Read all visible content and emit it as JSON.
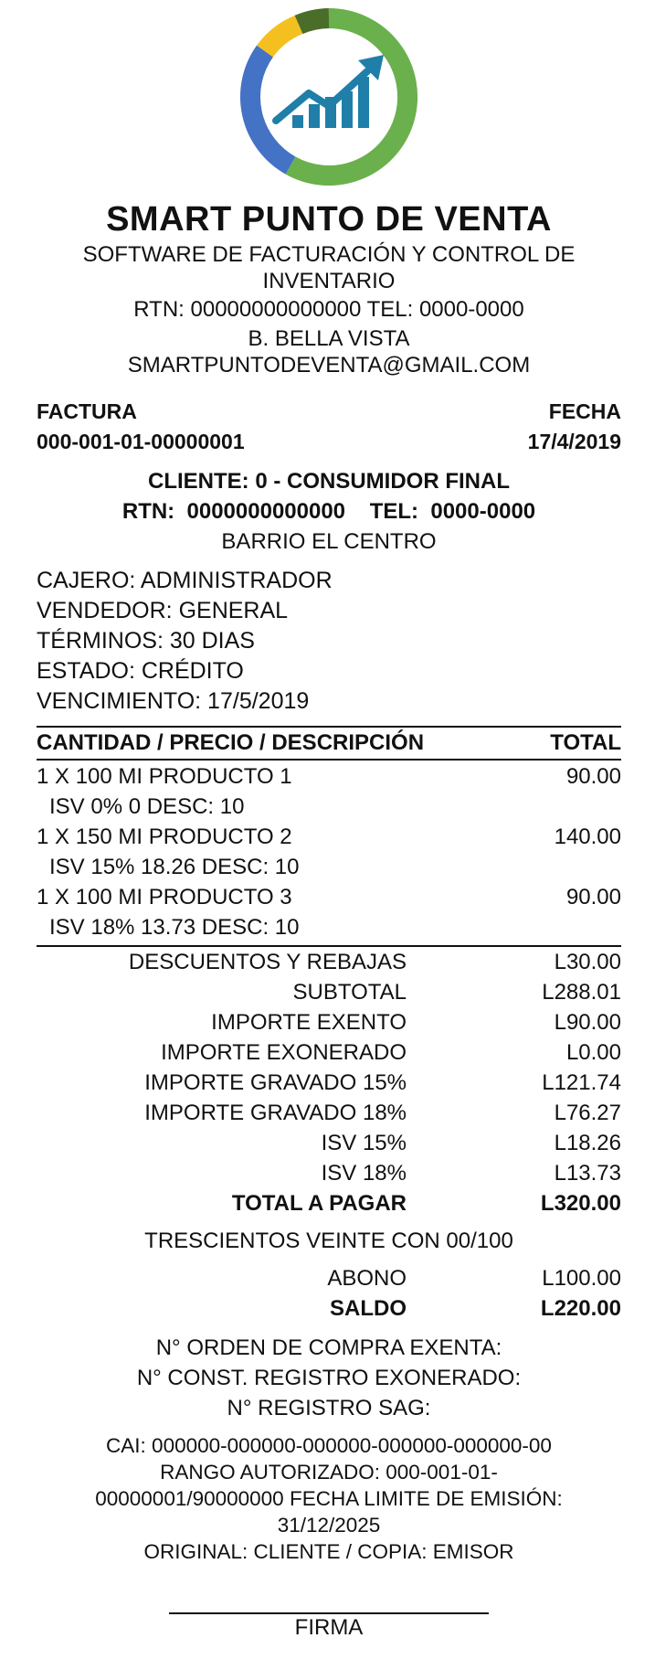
{
  "logo": {
    "icon": "chart-growth-icon",
    "ring_colors": [
      "#6ab04c",
      "#4472c4",
      "#f4c020",
      "#4a6e2a"
    ],
    "chart_color": "#1f7fa8"
  },
  "header": {
    "title": "SMART PUNTO DE VENTA",
    "subtitle_line1": "SOFTWARE DE FACTURACIÓN Y CONTROL DE",
    "subtitle_line2": "INVENTARIO",
    "rtn_tel": "RTN: 00000000000000 TEL: 0000-0000",
    "address": "B. BELLA VISTA",
    "email": "SMARTPUNTODEVENTA@GMAIL.COM"
  },
  "invoice": {
    "factura_label": "FACTURA",
    "fecha_label": "FECHA",
    "number": "000-001-01-00000001",
    "date": "17/4/2019"
  },
  "client": {
    "line1": "CLIENTE: 0 - CONSUMIDOR FINAL",
    "rtn_tel": "RTN:  0000000000000    TEL:  0000-0000",
    "address": "BARRIO EL CENTRO"
  },
  "meta": [
    "CAJERO: ADMINISTRADOR",
    "VENDEDOR: GENERAL",
    "TÉRMINOS: 30 DIAS",
    "ESTADO: CRÉDITO",
    "VENCIMIENTO: 17/5/2019"
  ],
  "items_header": {
    "description": "CANTIDAD / PRECIO / DESCRIPCIÓN",
    "total": "TOTAL"
  },
  "items": [
    {
      "line": "1 X 100 MI PRODUCTO 1",
      "total": "90.00",
      "detail": "ISV 0% 0 DESC: 10"
    },
    {
      "line": "1 X 150 MI PRODUCTO 2",
      "total": "140.00",
      "detail": "ISV 15% 18.26 DESC: 10"
    },
    {
      "line": "1 X 100 MI PRODUCTO 3",
      "total": "90.00",
      "detail": "ISV 18% 13.73 DESC: 10"
    }
  ],
  "totals": [
    {
      "label": "DESCUENTOS Y REBAJAS",
      "value": "L30.00"
    },
    {
      "label": "SUBTOTAL",
      "value": "L288.01"
    },
    {
      "label": "IMPORTE EXENTO",
      "value": "L90.00"
    },
    {
      "label": "IMPORTE EXONERADO",
      "value": "L0.00"
    },
    {
      "label": "IMPORTE GRAVADO 15%",
      "value": "L121.74"
    },
    {
      "label": "IMPORTE GRAVADO 18%",
      "value": "L76.27"
    },
    {
      "label": "ISV 15%",
      "value": "L18.26"
    },
    {
      "label": "ISV 18%",
      "value": "L13.73"
    },
    {
      "label": "TOTAL A PAGAR",
      "value": "L320.00"
    }
  ],
  "amount_words": "TRESCIENTOS VEINTE CON 00/100",
  "payment": [
    {
      "label": "ABONO",
      "value": "L100.00"
    },
    {
      "label": "SALDO",
      "value": "L220.00"
    }
  ],
  "registry": [
    "N° ORDEN DE COMPRA EXENTA:",
    "N° CONST. REGISTRO EXONERADO:",
    "N° REGISTRO SAG:"
  ],
  "legal": {
    "cai": "CAI: 000000-000000-000000-000000-000000-00",
    "range_line1": "RANGO AUTORIZADO: 000-001-01-",
    "range_line2": "00000001/90000000 FECHA LIMITE DE EMISIÓN:",
    "range_line3": "31/12/2025",
    "copies": "ORIGINAL: CLIENTE / COPIA: EMISOR"
  },
  "signature": {
    "label": "FIRMA"
  }
}
